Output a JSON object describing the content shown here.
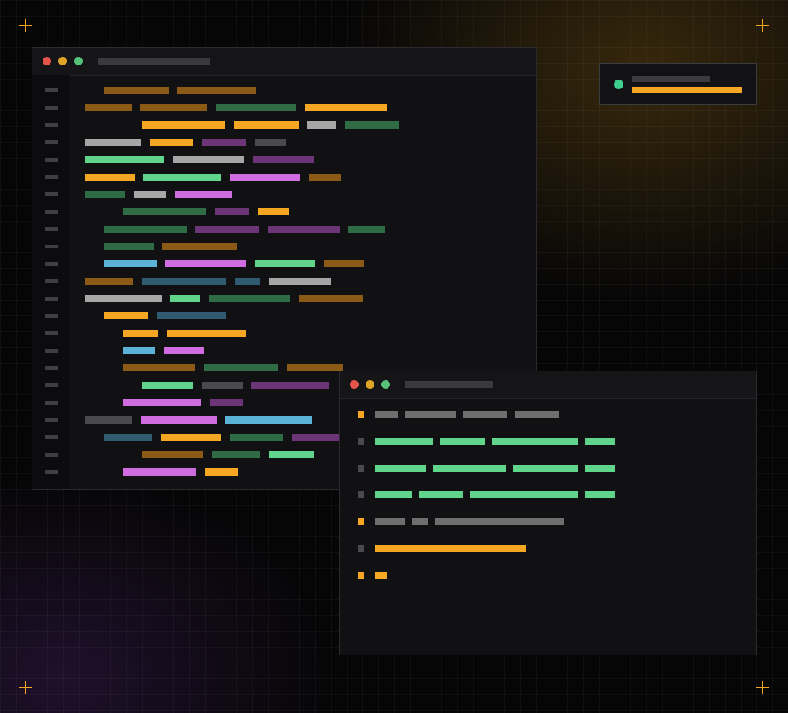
{
  "theme": {
    "background": "#060607",
    "accent": "#f5a623",
    "glow_top_right": "#aa7819",
    "glow_bottom_left": "#50236e"
  },
  "palette": {
    "orange": "#f5a623",
    "orange_dim": "#8a5a16",
    "green": "#5fd48a",
    "green_dim": "#2f6b45",
    "purple": "#cf6cdf",
    "purple_dim": "#6b3578",
    "blue": "#5ab2d6",
    "blue_dim": "#2f5a70",
    "gray_light": "#a6a6a6",
    "gray": "#6e6e6e",
    "gray_dim": "#4a4a4d"
  },
  "window_controls": [
    "close",
    "minimize",
    "maximize"
  ],
  "editor": {
    "line_count": 23,
    "lines": [
      {
        "indent": 1,
        "tokens": [
          {
            "w": 82,
            "c": "orange_dim"
          },
          {
            "w": 100,
            "c": "orange_dim"
          }
        ]
      },
      {
        "indent": 0,
        "tokens": [
          {
            "w": 59,
            "c": "orange_dim"
          },
          {
            "w": 85,
            "c": "orange_dim"
          },
          {
            "w": 102,
            "c": "green_dim"
          },
          {
            "w": 104,
            "c": "orange"
          }
        ]
      },
      {
        "indent": 3,
        "tokens": [
          {
            "w": 106,
            "c": "orange"
          },
          {
            "w": 82,
            "c": "orange"
          },
          {
            "w": 37,
            "c": "gray_light"
          },
          {
            "w": 68,
            "c": "green_dim"
          }
        ]
      },
      {
        "indent": 0,
        "tokens": [
          {
            "w": 71,
            "c": "gray_light"
          },
          {
            "w": 55,
            "c": "orange"
          },
          {
            "w": 56,
            "c": "purple_dim"
          },
          {
            "w": 40,
            "c": "gray_dim"
          }
        ]
      },
      {
        "indent": 0,
        "tokens": [
          {
            "w": 100,
            "c": "green"
          },
          {
            "w": 91,
            "c": "gray_light"
          },
          {
            "w": 78,
            "c": "purple_dim"
          }
        ]
      },
      {
        "indent": 0,
        "tokens": [
          {
            "w": 63,
            "c": "orange"
          },
          {
            "w": 99,
            "c": "green"
          },
          {
            "w": 89,
            "c": "purple"
          },
          {
            "w": 41,
            "c": "orange_dim"
          }
        ]
      },
      {
        "indent": 0,
        "tokens": [
          {
            "w": 51,
            "c": "green_dim"
          },
          {
            "w": 41,
            "c": "gray_light"
          },
          {
            "w": 72,
            "c": "purple"
          }
        ]
      },
      {
        "indent": 2,
        "tokens": [
          {
            "w": 106,
            "c": "green_dim"
          },
          {
            "w": 43,
            "c": "purple_dim"
          },
          {
            "w": 40,
            "c": "orange"
          }
        ]
      },
      {
        "indent": 1,
        "tokens": [
          {
            "w": 105,
            "c": "green_dim"
          },
          {
            "w": 81,
            "c": "purple_dim"
          },
          {
            "w": 91,
            "c": "purple_dim"
          },
          {
            "w": 46,
            "c": "green_dim"
          }
        ]
      },
      {
        "indent": 1,
        "tokens": [
          {
            "w": 63,
            "c": "green_dim"
          },
          {
            "w": 95,
            "c": "orange_dim"
          }
        ]
      },
      {
        "indent": 1,
        "tokens": [
          {
            "w": 67,
            "c": "blue"
          },
          {
            "w": 102,
            "c": "purple"
          },
          {
            "w": 77,
            "c": "green"
          },
          {
            "w": 51,
            "c": "orange_dim"
          }
        ]
      },
      {
        "indent": 0,
        "tokens": [
          {
            "w": 61,
            "c": "orange_dim"
          },
          {
            "w": 107,
            "c": "blue_dim"
          },
          {
            "w": 32,
            "c": "blue_dim"
          },
          {
            "w": 79,
            "c": "gray_light"
          }
        ]
      },
      {
        "indent": 0,
        "tokens": [
          {
            "w": 97,
            "c": "gray_light"
          },
          {
            "w": 38,
            "c": "green"
          },
          {
            "w": 103,
            "c": "green_dim"
          },
          {
            "w": 82,
            "c": "orange_dim"
          }
        ]
      },
      {
        "indent": 1,
        "tokens": [
          {
            "w": 56,
            "c": "orange"
          },
          {
            "w": 88,
            "c": "blue_dim"
          }
        ]
      },
      {
        "indent": 2,
        "tokens": [
          {
            "w": 45,
            "c": "orange"
          },
          {
            "w": 100,
            "c": "orange"
          }
        ]
      },
      {
        "indent": 2,
        "tokens": [
          {
            "w": 41,
            "c": "blue"
          },
          {
            "w": 51,
            "c": "purple"
          }
        ]
      },
      {
        "indent": 2,
        "tokens": [
          {
            "w": 92,
            "c": "orange_dim"
          },
          {
            "w": 94,
            "c": "green_dim"
          },
          {
            "w": 71,
            "c": "orange_dim"
          }
        ]
      },
      {
        "indent": 3,
        "tokens": [
          {
            "w": 65,
            "c": "green"
          },
          {
            "w": 52,
            "c": "gray_dim"
          },
          {
            "w": 99,
            "c": "purple_dim"
          }
        ]
      },
      {
        "indent": 2,
        "tokens": [
          {
            "w": 99,
            "c": "purple"
          },
          {
            "w": 43,
            "c": "purple_dim"
          }
        ]
      },
      {
        "indent": 0,
        "tokens": [
          {
            "w": 60,
            "c": "gray_dim"
          },
          {
            "w": 96,
            "c": "purple"
          },
          {
            "w": 110,
            "c": "blue"
          }
        ]
      },
      {
        "indent": 1,
        "tokens": [
          {
            "w": 61,
            "c": "blue_dim"
          },
          {
            "w": 77,
            "c": "orange"
          },
          {
            "w": 67,
            "c": "green_dim"
          },
          {
            "w": 64,
            "c": "purple_dim"
          }
        ]
      },
      {
        "indent": 3,
        "tokens": [
          {
            "w": 78,
            "c": "orange_dim"
          },
          {
            "w": 61,
            "c": "green_dim"
          },
          {
            "w": 58,
            "c": "green"
          }
        ]
      },
      {
        "indent": 2,
        "tokens": [
          {
            "w": 93,
            "c": "purple"
          },
          {
            "w": 42,
            "c": "orange"
          }
        ]
      }
    ]
  },
  "terminal": {
    "lines": [
      {
        "marker": "orange",
        "tokens": [
          {
            "w": 29,
            "c": "gray"
          },
          {
            "w": 65,
            "c": "gray"
          },
          {
            "w": 56,
            "c": "gray"
          },
          {
            "w": 56,
            "c": "gray"
          }
        ]
      },
      {
        "marker": "gray_dim",
        "tokens": [
          {
            "w": 74,
            "c": "green"
          },
          {
            "w": 56,
            "c": "green"
          },
          {
            "w": 110,
            "c": "green"
          },
          {
            "w": 38,
            "c": "green"
          }
        ]
      },
      {
        "marker": "gray_dim",
        "tokens": [
          {
            "w": 65,
            "c": "green"
          },
          {
            "w": 92,
            "c": "green"
          },
          {
            "w": 83,
            "c": "green"
          },
          {
            "w": 38,
            "c": "green"
          }
        ]
      },
      {
        "marker": "gray_dim",
        "tokens": [
          {
            "w": 47,
            "c": "green"
          },
          {
            "w": 56,
            "c": "green"
          },
          {
            "w": 137,
            "c": "green"
          },
          {
            "w": 38,
            "c": "green"
          }
        ]
      },
      {
        "marker": "orange",
        "tokens": [
          {
            "w": 38,
            "c": "gray"
          },
          {
            "w": 20,
            "c": "gray"
          },
          {
            "w": 164,
            "c": "gray"
          }
        ]
      },
      {
        "marker": "gray_dim",
        "tokens": [
          {
            "w": 192,
            "c": "orange"
          }
        ]
      },
      {
        "marker": "orange",
        "tokens": [
          {
            "w": 15,
            "c": "orange"
          }
        ]
      }
    ]
  }
}
